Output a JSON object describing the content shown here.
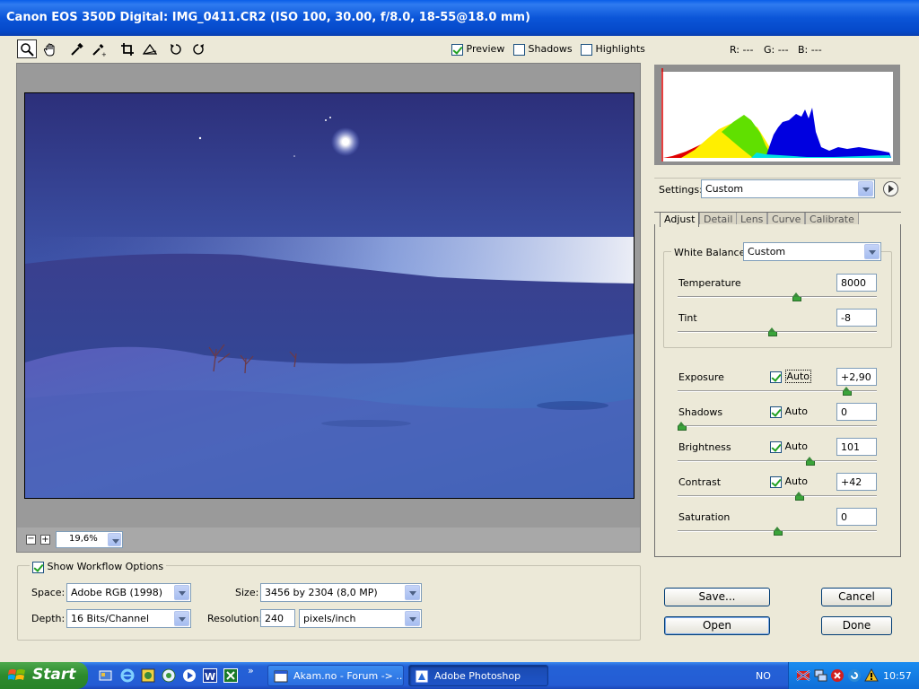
{
  "window": {
    "title": "Canon EOS 350D Digital:  IMG_0411.CR2  (ISO 100, 30.00, f/8.0, 18-55@18.0 mm)"
  },
  "toolbar": {
    "tools": [
      "zoom-tool",
      "hand-tool",
      "white-balance-tool",
      "color-sampler-tool",
      "crop-tool",
      "straighten-tool",
      "rotate-left-tool",
      "rotate-right-tool"
    ],
    "preview": {
      "label": "Preview",
      "checked": true
    },
    "shadows": {
      "label": "Shadows",
      "checked": false
    },
    "highlights": {
      "label": "Highlights",
      "checked": false
    },
    "rgb_readout": {
      "r": "R: ---",
      "g": "G: ---",
      "b": "B: ---"
    }
  },
  "zoom": {
    "value": "19,6%"
  },
  "workflow": {
    "show_label": "Show Workflow Options",
    "space_label": "Space:",
    "space_value": "Adobe RGB (1998)",
    "depth_label": "Depth:",
    "depth_value": "16 Bits/Channel",
    "size_label": "Size:",
    "size_value": "3456 by 2304  (8,0 MP)",
    "resolution_label": "Resolution:",
    "resolution_value": "240",
    "resolution_unit": "pixels/inch"
  },
  "settings": {
    "label": "Settings:",
    "value": "Custom"
  },
  "tabs": [
    "Adjust",
    "Detail",
    "Lens",
    "Curve",
    "Calibrate"
  ],
  "adjust": {
    "white_balance_label": "White Balance:",
    "white_balance_value": "Custom",
    "temperature": {
      "label": "Temperature",
      "value": "8000",
      "level": 0.6
    },
    "tint": {
      "label": "Tint",
      "value": "-8",
      "level": 0.47
    },
    "exposure": {
      "label": "Exposure",
      "value": "+2,90",
      "auto_label": "Auto",
      "auto": true,
      "level": 0.86
    },
    "shadows": {
      "label": "Shadows",
      "value": "0",
      "auto_label": "Auto",
      "auto": true,
      "level": 0.0
    },
    "brightness": {
      "label": "Brightness",
      "value": "101",
      "auto_label": "Auto",
      "auto": true,
      "level": 0.67
    },
    "contrast": {
      "label": "Contrast",
      "value": "+42",
      "auto_label": "Auto",
      "auto": true,
      "level": 0.61
    },
    "saturation": {
      "label": "Saturation",
      "value": "0",
      "level": 0.5
    }
  },
  "buttons": {
    "save": "Save...",
    "cancel": "Cancel",
    "open": "Open",
    "done": "Done"
  },
  "taskbar": {
    "start": "Start",
    "task1": "Akam.no - Forum -> ...",
    "task2": "Adobe Photoshop",
    "language": "NO",
    "clock": "10:57"
  },
  "colors": {
    "titlebar": "#0b55d8",
    "slider_thumb": "#3aa43a",
    "taskbar": "#245cd4"
  }
}
